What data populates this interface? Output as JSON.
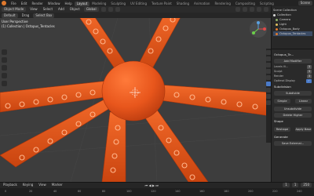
{
  "menus": [
    "File",
    "Edit",
    "Render",
    "Window",
    "Help"
  ],
  "workspace_tabs": [
    "Layout",
    "Modeling",
    "Sculpting",
    "UV Editing",
    "Texture Paint",
    "Shading",
    "Animation",
    "Rendering",
    "Compositing",
    "Scripting"
  ],
  "active_tab": "Layout",
  "scene": "Scene",
  "header2": {
    "mode": "Object Mode",
    "view": "View",
    "select": "Select",
    "add": "Add",
    "object": "Object",
    "transform": "Global"
  },
  "header3": {
    "orientation": "Default",
    "drag": "Drag",
    "select": "Select Box"
  },
  "viewport": {
    "line1": "User Perspective",
    "line2": "(1) Collection | Octopus_Tentacles",
    "orange": "#e45a1e"
  },
  "outliner": {
    "title": "Scene Collection",
    "items": [
      "Collection",
      "Camera",
      "Light",
      "Octopus_Body",
      "Octopus_Tentacles"
    ],
    "selected": "Octopus_Tentacles"
  },
  "properties": {
    "object": "Octopus_Te...",
    "add_modifier": "Add Modifier",
    "fields": [
      {
        "label": "Levels Vi...",
        "value": "3"
      },
      {
        "label": "Sculpt",
        "value": "3"
      },
      {
        "label": "Render",
        "value": "3"
      }
    ],
    "optimal": "Optimal Display",
    "subdivision": "Subdivision",
    "subdivide": "Subdivide",
    "simple": "Simple",
    "linear": "Linear",
    "unsubdivide": "Unsubdivide",
    "delete_higher": "Delete Higher",
    "shape": "Shape",
    "reshape": "Reshape",
    "apply_base": "Apply Base",
    "generate": "Generate",
    "save_external": "Save External..."
  },
  "timeline": {
    "playback": "Playback",
    "keying": "Keying",
    "view": "View",
    "marker": "Marker",
    "start": "1",
    "end": "250",
    "frame": "1",
    "ticks": [
      "0",
      "20",
      "40",
      "60",
      "80",
      "100",
      "120",
      "140",
      "160",
      "180",
      "200",
      "220",
      "240"
    ]
  }
}
